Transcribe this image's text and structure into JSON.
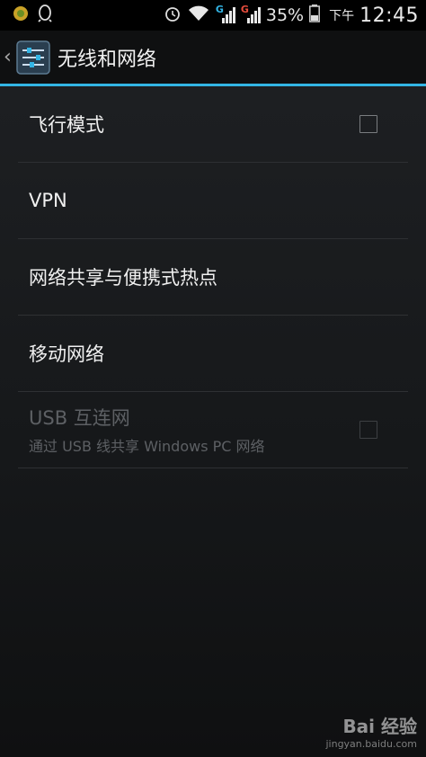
{
  "status_bar": {
    "left_icons": [
      "game-notification-icon",
      "qq-penguin-icon"
    ],
    "right_icons": [
      "alarm-icon",
      "wifi-icon",
      "signal-g-icon",
      "signal-g2-icon",
      "battery-icon"
    ],
    "signal_label_1": "G",
    "signal_label_2": "G",
    "battery_percent": "35%",
    "ampm": "下午",
    "time": "12:45"
  },
  "action_bar": {
    "title": "无线和网络",
    "accent_color": "#33b5e5"
  },
  "settings": [
    {
      "title": "飞行模式",
      "has_checkbox": true,
      "checked": false,
      "enabled": true
    },
    {
      "title": "VPN",
      "has_checkbox": false,
      "enabled": true
    },
    {
      "title": "网络共享与便携式热点",
      "has_checkbox": false,
      "enabled": true
    },
    {
      "title": "移动网络",
      "has_checkbox": false,
      "enabled": true
    },
    {
      "title": "USB 互连网",
      "summary": "通过 USB 线共享 Windows PC 网络",
      "has_checkbox": true,
      "checked": false,
      "enabled": false
    }
  ],
  "watermark": {
    "logo": "Bai 经验",
    "url": "jingyan.baidu.com"
  }
}
